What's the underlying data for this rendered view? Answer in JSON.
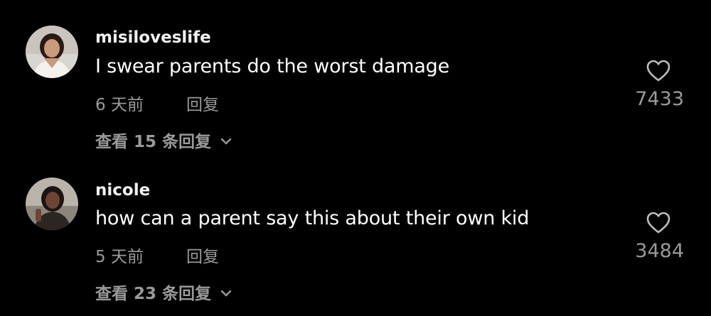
{
  "comments": [
    {
      "username": "misiloveslife",
      "text": "I swear parents do the worst damage",
      "time": "6 天前",
      "reply_label": "回复",
      "likes": "7433",
      "view_replies": "查看 15 条回复"
    },
    {
      "username": "nicole",
      "text": "how can a parent say this about their own kid",
      "time": "5 天前",
      "reply_label": "回复",
      "likes": "3484",
      "view_replies": "查看 23 条回复"
    }
  ],
  "icons": {
    "like": "heart-outline-icon",
    "expand": "chevron-down-icon"
  },
  "colors": {
    "background": "#000000",
    "primary_text": "#ffffff",
    "secondary_text": "#9a9a9a"
  }
}
